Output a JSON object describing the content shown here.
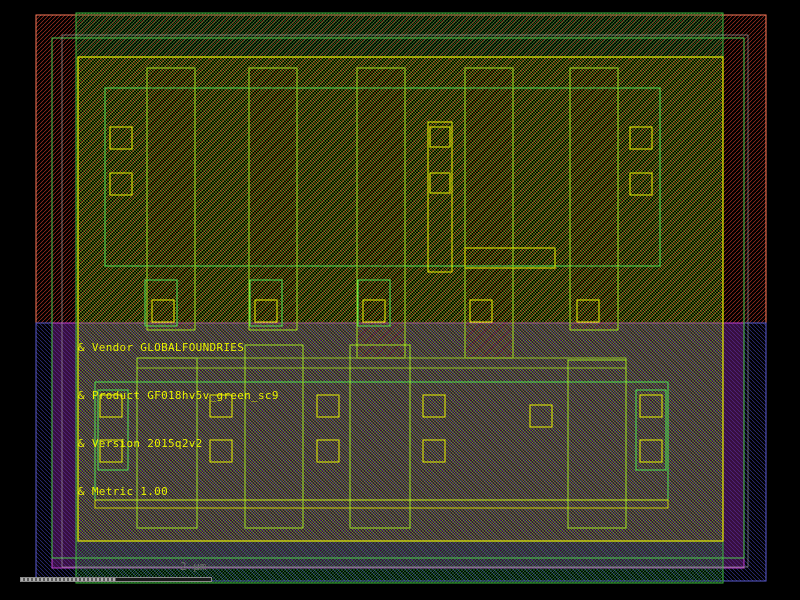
{
  "annotations": {
    "vendor": "& Vendor GLOBALFOUNDRIES",
    "product": "& Product GF018hv5v_green_sc9",
    "version": "& Version 2015q2v2",
    "metric": "& Metric 1.00"
  },
  "scale": {
    "label": "2 µm",
    "fill_fraction": 0.5
  },
  "colors": {
    "background": "#000000",
    "nwell": "#ff7a5a",
    "pwell": "#6a5acd",
    "diffusion": "#00c850",
    "poly": "#d00000",
    "metal1": "#e8f000",
    "contact": "#e8f000"
  }
}
